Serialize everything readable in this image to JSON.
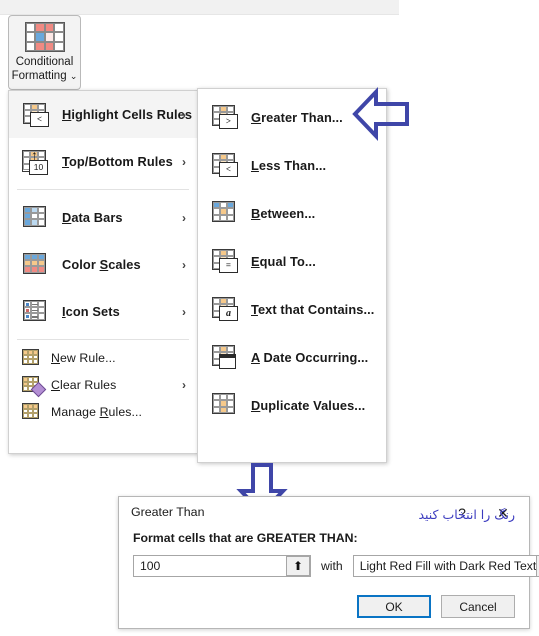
{
  "ribbon": {
    "button": {
      "label_line1": "Conditional",
      "label_line2": "Formatting",
      "chevron": "⌄",
      "icon": "conditional-formatting-icon"
    }
  },
  "menu_main": {
    "items": [
      {
        "label_accel": "H",
        "label_rest": "ighlight Cells Rules",
        "icon": "highlight-cells-rules-icon",
        "submenu_arrow": "›",
        "selected": true
      },
      {
        "label_accel": "T",
        "label_rest": "op/Bottom Rules",
        "icon": "top-bottom-rules-icon",
        "submenu_arrow": "›",
        "selected": false
      },
      {
        "label_accel": "D",
        "label_rest": "ata Bars",
        "icon": "data-bars-icon",
        "submenu_arrow": "›",
        "selected": false
      },
      {
        "label_accel": "S",
        "label_rest": "Color Scales",
        "icon": "color-scales-icon",
        "submenu_arrow": "›",
        "selected": false
      },
      {
        "label_accel": "I",
        "label_rest": "con Sets",
        "icon": "icon-sets-icon",
        "submenu_arrow": "›",
        "selected": false
      }
    ],
    "commands": [
      {
        "label_accel": "N",
        "label_rest": "ew Rule...",
        "icon": "new-rule-icon",
        "submenu_arrow": ""
      },
      {
        "label_accel": "C",
        "label_rest": "lear Rules",
        "icon": "clear-rules-icon",
        "submenu_arrow": "›"
      },
      {
        "label_accel": "R",
        "label_rest": "Manage Rules...",
        "icon": "manage-rules-icon",
        "submenu_arrow": ""
      }
    ]
  },
  "menu_sub": {
    "items": [
      {
        "label_accel": "G",
        "label_rest": "reater Than...",
        "icon": "greater-than-icon",
        "badge": "&gt;"
      },
      {
        "label_accel": "L",
        "label_rest": "ess Than...",
        "icon": "less-than-icon",
        "badge": "&lt;"
      },
      {
        "label_accel": "B",
        "label_rest": "etween...",
        "icon": "between-icon",
        "badge": ""
      },
      {
        "label_accel": "E",
        "label_rest": "qual To...",
        "icon": "equal-to-icon",
        "badge": "="
      },
      {
        "label_accel": "T",
        "label_rest": "ext that Contains...",
        "icon": "text-that-contains-icon",
        "badge": "a"
      },
      {
        "label_accel": "A",
        "label_rest": " Date Occurring...",
        "icon": "a-date-occurring-icon",
        "badge": ""
      },
      {
        "label_accel": "D",
        "label_rest": "uplicate Values...",
        "icon": "duplicate-values-icon",
        "badge": ""
      }
    ]
  },
  "annotations": {
    "arrow_left": "left-arrow-annotation",
    "arrow_down": "down-arrow-annotation",
    "color": "#3f46a8"
  },
  "dialog": {
    "title": "Greater Than",
    "help_glyph": "?",
    "close_glyph": "✕",
    "prompt": "Format cells that are GREATER THAN:",
    "value": "100",
    "value_placeholder": "",
    "range_picker_glyph": "⬆",
    "with_label": "with",
    "format_value": "Light Red Fill with Dark Red Text",
    "format_caret": "⌄",
    "persian_note": "رنگ را انتخاب کنید",
    "ok_label": "OK",
    "cancel_label": "Cancel"
  },
  "colors": {
    "orange_fill": "#f6c98b",
    "blue_fill": "#6aa8dc",
    "red_fill": "#f08a83",
    "annotation": "#3f46a8",
    "focus_blue": "#0a74c4"
  }
}
